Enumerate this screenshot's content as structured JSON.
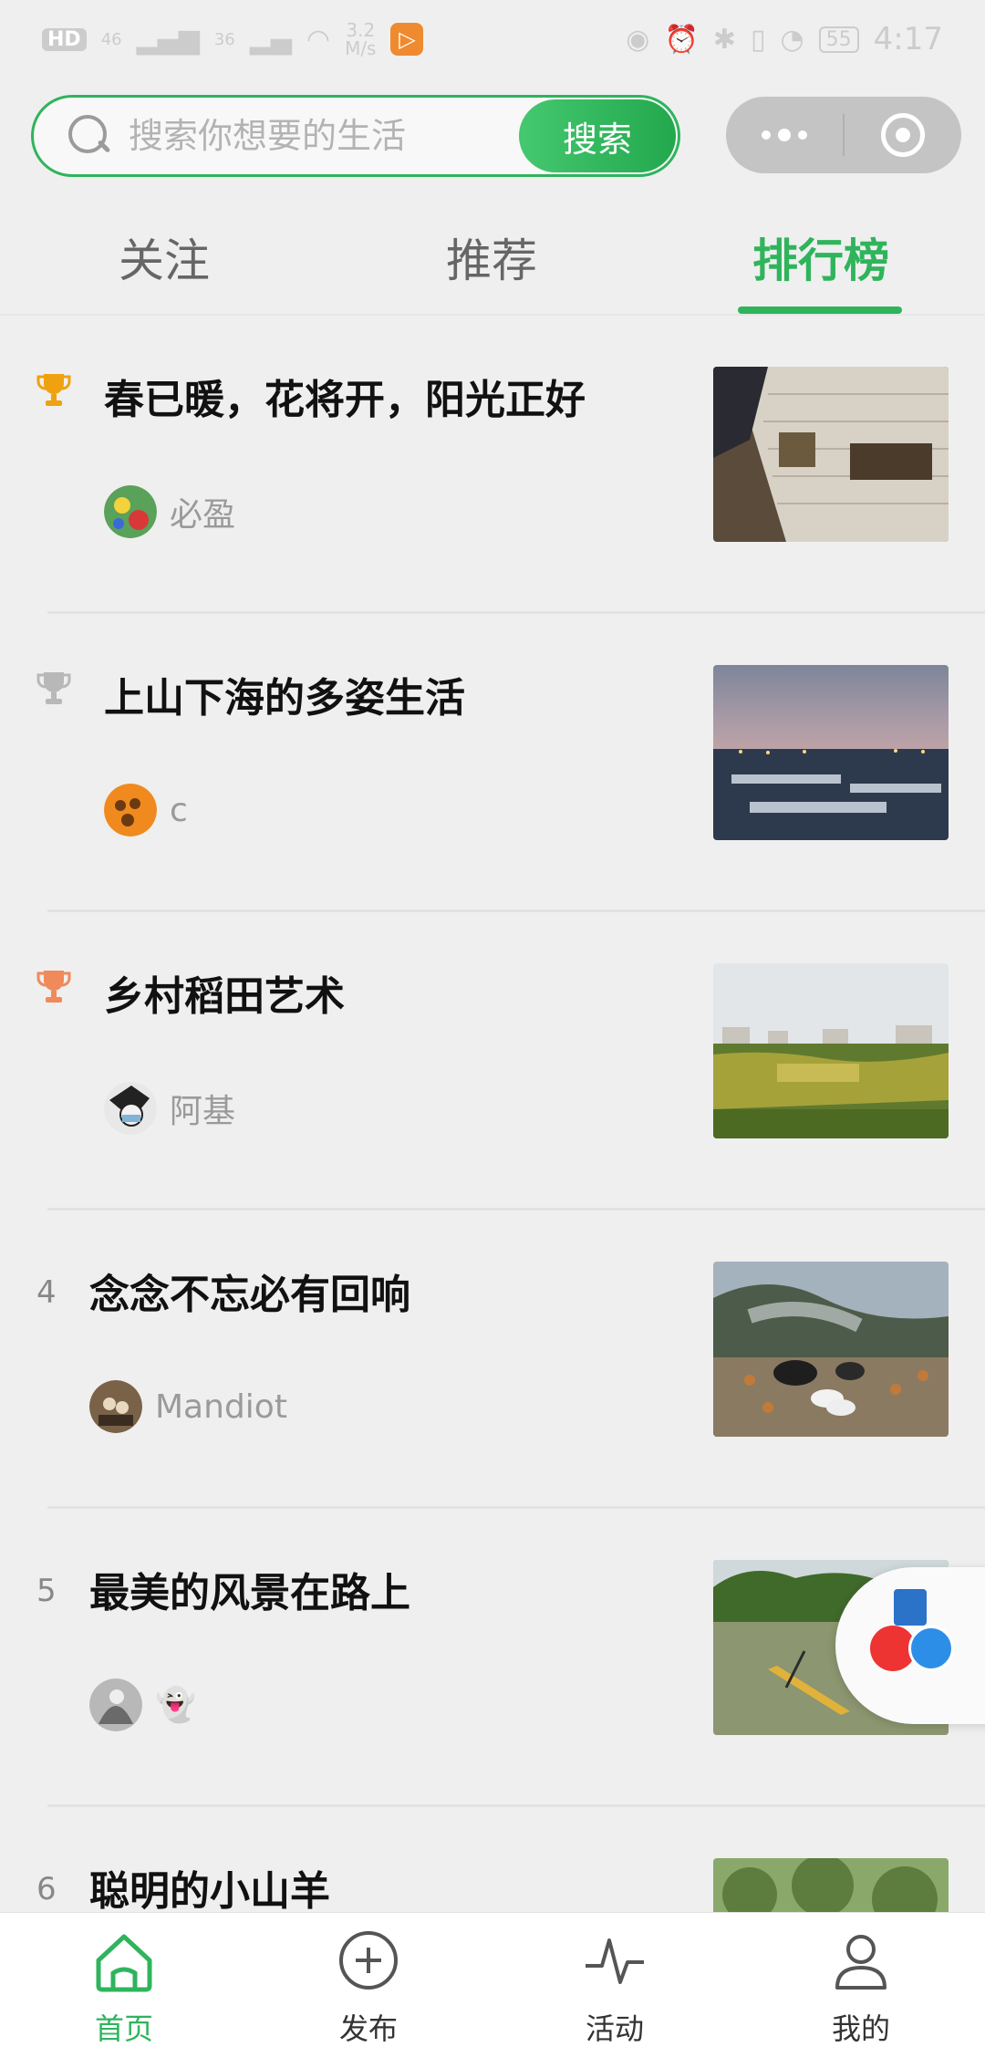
{
  "status_bar": {
    "left_badges": [
      "HD",
      "46",
      "36"
    ],
    "speed": "3.2\nM/s",
    "battery": "55",
    "time": "4:17"
  },
  "search": {
    "placeholder": "搜索你想要的生活",
    "button_label": "搜索"
  },
  "tabs": [
    {
      "label": "关注",
      "active": false
    },
    {
      "label": "推荐",
      "active": false
    },
    {
      "label": "排行榜",
      "active": true
    }
  ],
  "accent_color": "#2fb45c",
  "ranking": [
    {
      "rank": 1,
      "rank_icon": "gold-trophy-icon",
      "title": "春已暖，花将开，阳光正好",
      "author": "必盈"
    },
    {
      "rank": 2,
      "rank_icon": "silver-trophy-icon",
      "title": "上山下海的多姿生活",
      "author": "c"
    },
    {
      "rank": 3,
      "rank_icon": "bronze-trophy-icon",
      "title": "乡村稻田艺术",
      "author": "阿基"
    },
    {
      "rank": 4,
      "rank_label": "4",
      "title": "念念不忘必有回响",
      "author": "Mandiot"
    },
    {
      "rank": 5,
      "rank_label": "5",
      "title": "最美的风景在路上",
      "author": "👻"
    },
    {
      "rank": 6,
      "rank_label": "6",
      "title": "聪明的小山羊",
      "author": ""
    }
  ],
  "bottom_nav": [
    {
      "label": "首页",
      "icon": "home-icon",
      "active": true
    },
    {
      "label": "发布",
      "icon": "plus-circle-icon",
      "active": false
    },
    {
      "label": "活动",
      "icon": "pulse-icon",
      "active": false
    },
    {
      "label": "我的",
      "icon": "user-icon",
      "active": false
    }
  ]
}
